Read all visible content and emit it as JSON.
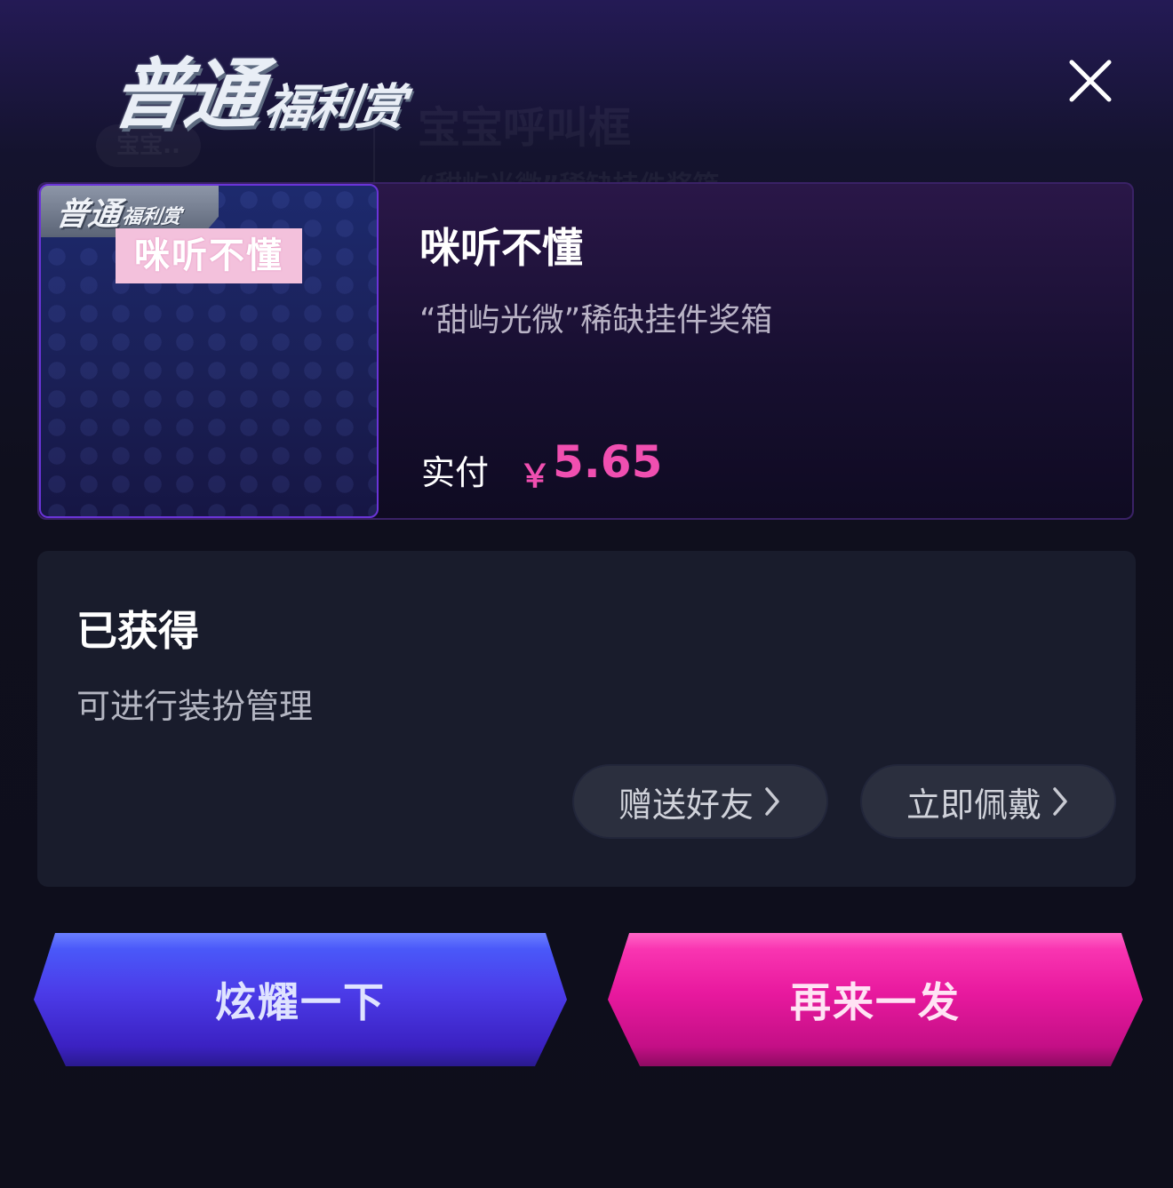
{
  "background": {
    "ghost_title": "宝宝呼叫框",
    "ghost_sub": "“甜屿光微”稀缺挂件奖箱",
    "ghost_bubble": "宝宝.."
  },
  "header": {
    "logo_big": "普通",
    "logo_small": "福利赏",
    "close_icon": "close-icon"
  },
  "prize": {
    "badge_big": "普通",
    "badge_small": "福利赏",
    "thumb_tag": "咪听不懂",
    "name": "咪听不懂",
    "description": "“甜屿光微”稀缺挂件奖箱",
    "pay_label": "实付",
    "currency": "￥",
    "price": "5.65"
  },
  "obtained": {
    "title": "已获得",
    "subtitle": "可进行装扮管理",
    "gift_label": "赠送好友",
    "wear_label": "立即佩戴"
  },
  "actions": {
    "show_off_label": "炫耀一下",
    "again_label": "再来一发"
  },
  "colors": {
    "price": "#f04fb0",
    "show_button": "#4b3be8",
    "again_button": "#e8199e"
  }
}
